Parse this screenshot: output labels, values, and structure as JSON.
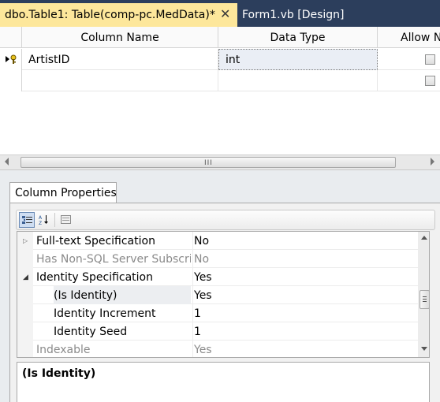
{
  "tabs": {
    "active_label": "dbo.Table1: Table(comp-pc.MedData)*",
    "close_glyph": "✕",
    "inactive_label": "Form1.vb [Design]"
  },
  "grid": {
    "headers": [
      "Column Name",
      "Data Type",
      "Allow Nulls"
    ],
    "rows": [
      {
        "column_name": "ArtistID",
        "data_type": "int",
        "allow_nulls": false,
        "primary_key": true
      },
      {
        "column_name": "",
        "data_type": "",
        "allow_nulls": false,
        "primary_key": false
      }
    ]
  },
  "hscroll": {
    "grip": "III"
  },
  "column_properties": {
    "tab_label": "Column Properties",
    "toolbar": {
      "categorized_icon": "categorized-icon",
      "alphabetical_icon": "sort-az-icon",
      "property_pages_icon": "property-pages-icon"
    },
    "properties": [
      {
        "name": "Full-text Specification",
        "value": "No",
        "expander": "▷",
        "greyed": false
      },
      {
        "name": "Has Non-SQL Server Subscriber",
        "value": "No",
        "expander": "",
        "greyed": true
      },
      {
        "name": "Identity Specification",
        "value": "Yes",
        "expander": "◢",
        "greyed": false
      },
      {
        "name": "(Is Identity)",
        "value": "Yes",
        "expander": "",
        "greyed": false
      },
      {
        "name": "Identity Increment",
        "value": "1",
        "expander": "",
        "greyed": false
      },
      {
        "name": "Identity Seed",
        "value": "1",
        "expander": "",
        "greyed": false
      },
      {
        "name": "Indexable",
        "value": "Yes",
        "expander": "",
        "greyed": true
      }
    ],
    "description": "(Is Identity)"
  },
  "colors": {
    "tab_strip": "#2c3e5c",
    "active_tab": "#fde79b",
    "panel_background": "#e9ecef"
  }
}
